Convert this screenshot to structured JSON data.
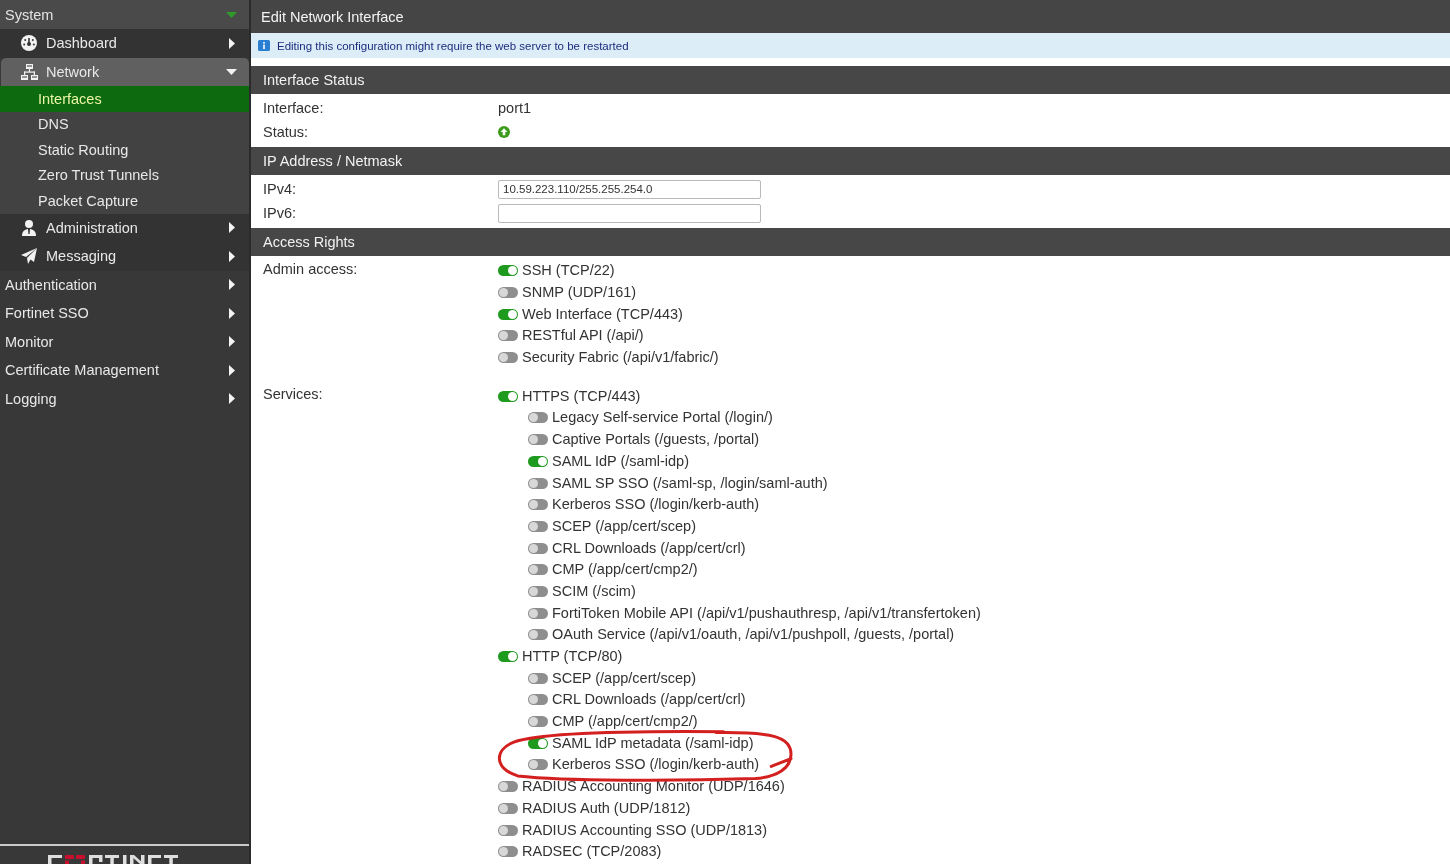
{
  "sidebar": {
    "items": [
      {
        "label": "System",
        "expanded": true,
        "children": [
          {
            "label": "Dashboard",
            "expanded": false
          },
          {
            "label": "Network",
            "expanded": true,
            "children": [
              {
                "label": "Interfaces",
                "selected": true
              },
              {
                "label": "DNS",
                "selected": false
              },
              {
                "label": "Static Routing",
                "selected": false
              },
              {
                "label": "Zero Trust Tunnels",
                "selected": false
              },
              {
                "label": "Packet Capture",
                "selected": false
              }
            ]
          },
          {
            "label": "Administration",
            "expanded": false
          },
          {
            "label": "Messaging",
            "expanded": false
          }
        ]
      },
      {
        "label": "Authentication",
        "expanded": false
      },
      {
        "label": "Fortinet SSO",
        "expanded": false
      },
      {
        "label": "Monitor",
        "expanded": false
      },
      {
        "label": "Certificate Management",
        "expanded": false
      },
      {
        "label": "Logging",
        "expanded": false
      }
    ]
  },
  "page": {
    "title": "Edit Network Interface",
    "notice": "Editing this configuration might require the web server to be restarted"
  },
  "sections": [
    {
      "title": "Interface Status",
      "rows": [
        {
          "kind": "text",
          "label": "Interface:",
          "value": "port1"
        },
        {
          "kind": "status",
          "label": "Status:",
          "up": true
        }
      ]
    },
    {
      "title": "IP Address / Netmask",
      "rows": [
        {
          "kind": "input",
          "label": "IPv4:",
          "value": "10.59.223.110/255.255.254.0"
        },
        {
          "kind": "input",
          "label": "IPv6:"
        }
      ]
    },
    {
      "title": "Access Rights",
      "rows": [
        {
          "kind": "toggles",
          "label": "Admin access:",
          "items": [
            {
              "label": "SSH (TCP/22)",
              "on": true
            },
            {
              "label": "SNMP (UDP/161)",
              "on": false
            },
            {
              "label": "Web Interface (TCP/443)",
              "on": true
            },
            {
              "label": "RESTful API (/api/)",
              "on": false
            },
            {
              "label": "Security Fabric (/api/v1/fabric/)",
              "on": false
            }
          ]
        },
        {
          "kind": "toggles",
          "label": "Services:",
          "items": [
            {
              "label": "HTTPS (TCP/443)",
              "on": true,
              "children": [
                {
                  "label": "Legacy Self-service Portal (/login/)",
                  "on": false
                },
                {
                  "label": "Captive Portals (/guests, /portal)",
                  "on": false
                },
                {
                  "label": "SAML IdP (/saml-idp)",
                  "on": true
                },
                {
                  "label": "SAML SP SSO (/saml-sp, /login/saml-auth)",
                  "on": false
                },
                {
                  "label": "Kerberos SSO (/login/kerb-auth)",
                  "on": false
                },
                {
                  "label": "SCEP (/app/cert/scep)",
                  "on": false
                },
                {
                  "label": "CRL Downloads (/app/cert/crl)",
                  "on": false
                },
                {
                  "label": "CMP (/app/cert/cmp2/)",
                  "on": false
                },
                {
                  "label": "SCIM (/scim)",
                  "on": false
                },
                {
                  "label": "FortiToken Mobile API (/api/v1/pushauthresp, /api/v1/transfertoken)",
                  "on": false
                },
                {
                  "label": "OAuth Service (/api/v1/oauth, /api/v1/pushpoll, /guests, /portal)",
                  "on": false
                }
              ]
            },
            {
              "label": "HTTP (TCP/80)",
              "on": true,
              "children": [
                {
                  "label": "SCEP (/app/cert/scep)",
                  "on": false,
                  "circled": false
                },
                {
                  "label": "CRL Downloads (/app/cert/crl)",
                  "on": false,
                  "circled": false
                },
                {
                  "label": "CMP (/app/cert/cmp2/)",
                  "on": false,
                  "circled": false
                },
                {
                  "label": "SAML IdP metadata (/saml-idp)",
                  "on": true,
                  "circled": true
                },
                {
                  "label": "Kerberos SSO (/login/kerb-auth)",
                  "on": false,
                  "circled": true
                }
              ]
            },
            {
              "label": "RADIUS Accounting Monitor (UDP/1646)",
              "on": false
            },
            {
              "label": "RADIUS Auth (UDP/1812)",
              "on": false
            },
            {
              "label": "RADIUS Accounting SSO (UDP/1813)",
              "on": false
            },
            {
              "label": "RADSEC (TCP/2083)",
              "on": false
            }
          ]
        }
      ]
    }
  ]
}
